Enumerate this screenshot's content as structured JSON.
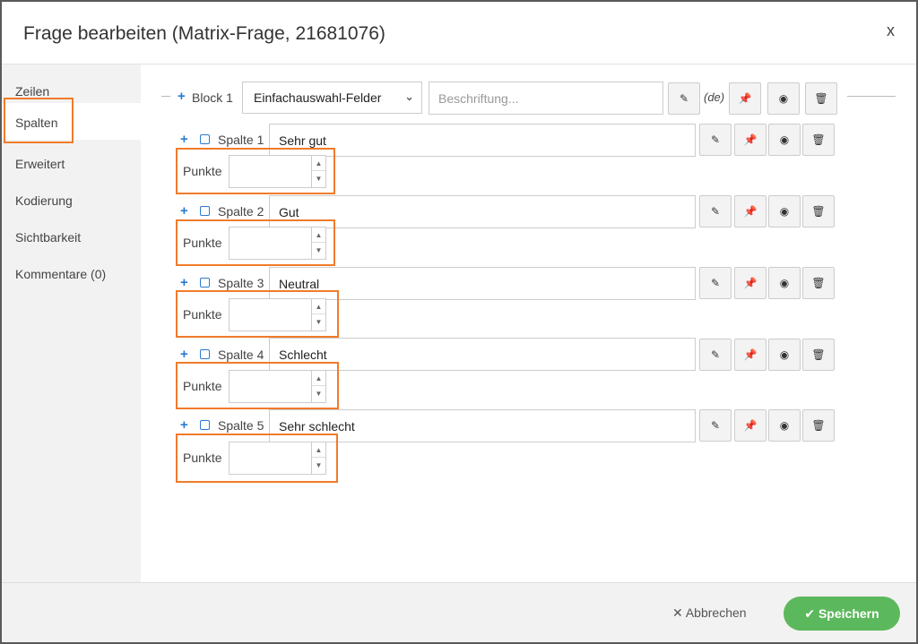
{
  "dialog": {
    "title": "Frage bearbeiten (Matrix-Frage, 21681076)",
    "close_label": "x"
  },
  "sidebar": {
    "items": [
      {
        "label": "Zeilen",
        "active": false
      },
      {
        "label": "Spalten",
        "active": true
      },
      {
        "label": "Erweitert",
        "active": false
      },
      {
        "label": "Kodierung",
        "active": false
      },
      {
        "label": "Sichtbarkeit",
        "active": false
      },
      {
        "label": "Kommentare (0)",
        "active": false
      }
    ]
  },
  "block": {
    "label": "Block 1",
    "type_selected": "Einfachauswahl-Felder",
    "caption_placeholder": "Beschriftung...",
    "lang": "(de)"
  },
  "columns": [
    {
      "label": "Spalte 1",
      "text": "Sehr gut",
      "points_label": "Punkte",
      "points_value": ""
    },
    {
      "label": "Spalte 2",
      "text": "Gut",
      "points_label": "Punkte",
      "points_value": ""
    },
    {
      "label": "Spalte 3",
      "text": "Neutral",
      "points_label": "Punkte",
      "points_value": ""
    },
    {
      "label": "Spalte 4",
      "text": "Schlecht",
      "points_label": "Punkte",
      "points_value": ""
    },
    {
      "label": "Spalte 5",
      "text": "Sehr schlecht",
      "points_label": "Punkte",
      "points_value": ""
    }
  ],
  "icons": {
    "plus": "+",
    "pencil": "✎",
    "pin": "📌",
    "eye": "◉",
    "trash": "🗑",
    "chevron": "⌄",
    "spin_up": "▲",
    "spin_down": "▼"
  },
  "footer": {
    "cancel_label": "✕ Abbrechen",
    "save_label": "✔ Speichern"
  },
  "colors": {
    "accent_blue": "#2a7ad2",
    "highlight_orange": "#f07b2a",
    "save_green": "#5cb85c",
    "pin_red": "#b22222"
  }
}
